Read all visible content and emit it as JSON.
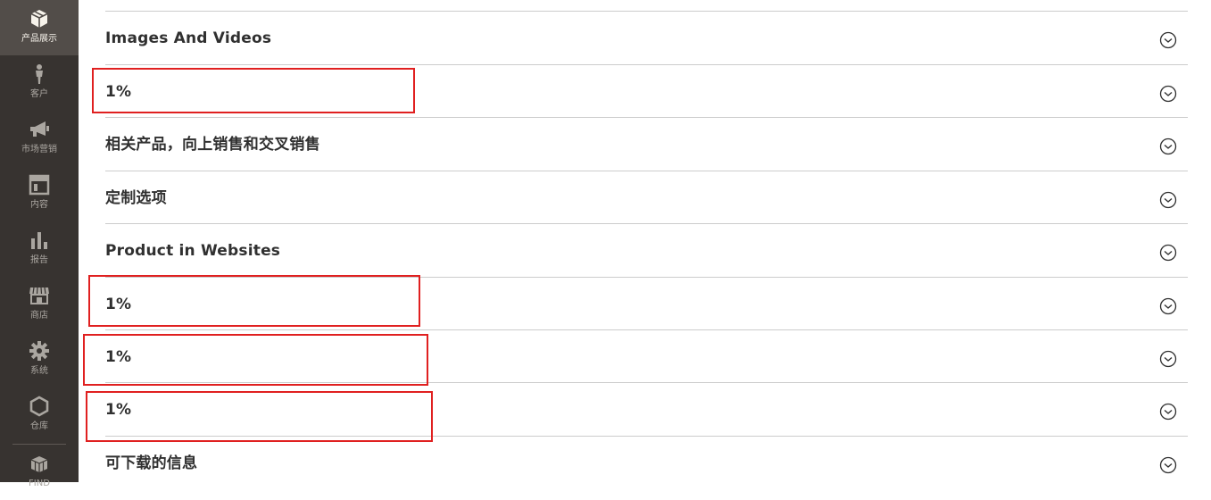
{
  "sidebar": {
    "items": [
      {
        "label": "产品展示",
        "icon": "cube-icon"
      },
      {
        "label": "客户",
        "icon": "person-icon"
      },
      {
        "label": "市场营销",
        "icon": "megaphone-icon"
      },
      {
        "label": "内容",
        "icon": "layout-icon"
      },
      {
        "label": "报告",
        "icon": "bar-chart-icon"
      },
      {
        "label": "商店",
        "icon": "storefront-icon"
      },
      {
        "label": "系统",
        "icon": "gear-icon"
      },
      {
        "label": "仓库",
        "icon": "hexagon-icon"
      },
      {
        "label": "FIND",
        "icon": "extensions-icon"
      }
    ]
  },
  "sections": [
    {
      "title": "Images And Videos",
      "icon": "chevron-down-circle-icon"
    },
    {
      "title": "1%",
      "icon": "chevron-down-circle-icon"
    },
    {
      "title": "相关产品，向上销售和交叉销售",
      "icon": "chevron-down-circle-icon"
    },
    {
      "title": "定制选项",
      "icon": "chevron-down-circle-icon"
    },
    {
      "title": "Product in Websites",
      "icon": "chevron-down-circle-icon"
    },
    {
      "title": "1%",
      "icon": "chevron-down-circle-icon"
    },
    {
      "title": "1%",
      "icon": "chevron-down-circle-icon"
    },
    {
      "title": "1%",
      "icon": "chevron-down-circle-icon"
    },
    {
      "title": "可下载的信息",
      "icon": "chevron-down-circle-icon"
    }
  ],
  "colors": {
    "sidebar_bg": "#373330",
    "sidebar_active": "#524d49",
    "highlight_red": "#e02020",
    "divider": "#cccccc"
  }
}
